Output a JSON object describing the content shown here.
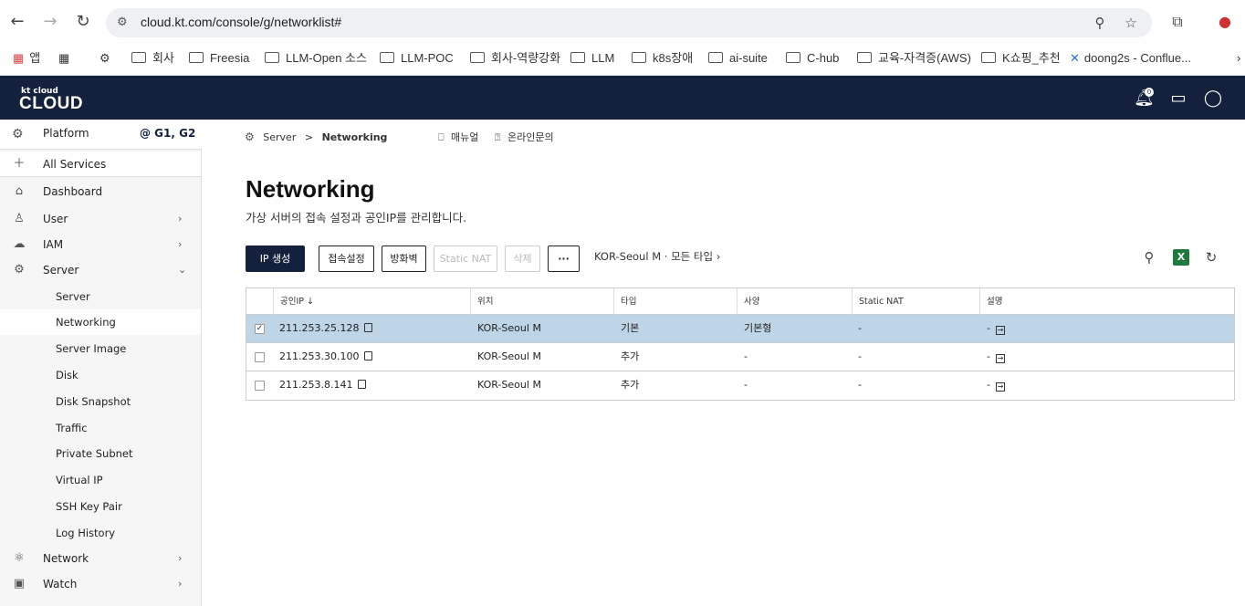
{
  "browser": {
    "url": "cloud.kt.com/console/g/networklist#",
    "bookmarks": [
      "앱",
      "회사",
      "Freesia",
      "LLM-Open 소스",
      "LLM-POC",
      "회사-역량강화",
      "LLM",
      "k8s장애",
      "ai-suite",
      "C-hub",
      "교육-자격증(AWS)",
      "K쇼핑_추천",
      "doong2s - Conflue..."
    ]
  },
  "header": {
    "logo_small": "kt cloud",
    "logo_big": "CLOUD",
    "notification_count": "0"
  },
  "sidebar": {
    "platform_label": "Platform",
    "platform_badge": "@ G1, G2",
    "items": [
      {
        "label": "All Services"
      },
      {
        "label": "Dashboard"
      },
      {
        "label": "User"
      },
      {
        "label": "IAM"
      },
      {
        "label": "Server"
      },
      {
        "label": "Network"
      },
      {
        "label": "Watch"
      }
    ],
    "server_sub": [
      "Server",
      "Networking",
      "Server Image",
      "Disk",
      "Disk Snapshot",
      "Traffic",
      "Private Subnet",
      "Virtual IP",
      "SSH Key Pair",
      "Log History"
    ]
  },
  "breadcrumb": {
    "parent": "Server",
    "sep": ">",
    "current": "Networking",
    "manual": "매뉴얼",
    "inquiry": "온라인문의"
  },
  "page": {
    "title": "Networking",
    "description": "가상 서버의 접속 설정과 공인IP를 관리합니다."
  },
  "toolbar": {
    "create_ip": "IP 생성",
    "access_setting": "접속설정",
    "firewall": "방화벽",
    "static_nat": "Static NAT",
    "delete": "삭제",
    "more": "···",
    "filter": "KOR-Seoul M · 모든 타입 ›"
  },
  "table": {
    "headers": [
      "공인IP ↓",
      "위치",
      "타입",
      "사양",
      "Static NAT",
      "설명"
    ],
    "rows": [
      {
        "ip": "211.253.25.128",
        "location": "KOR-Seoul M",
        "type": "기본",
        "spec": "기본형",
        "static_nat": "-",
        "desc": "-",
        "selected": true
      },
      {
        "ip": "211.253.30.100",
        "location": "KOR-Seoul M",
        "type": "추가",
        "spec": "-",
        "static_nat": "-",
        "desc": "-",
        "selected": false
      },
      {
        "ip": "211.253.8.141",
        "location": "KOR-Seoul M",
        "type": "추가",
        "spec": "-",
        "static_nat": "-",
        "desc": "-",
        "selected": false
      }
    ]
  }
}
